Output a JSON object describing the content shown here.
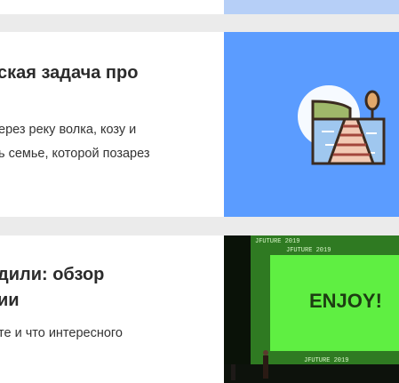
{
  "articles": [
    {
      "title_lines": [
        "ская задача про"
      ],
      "excerpt_lines": [
        "ерез реку волка, козу и",
        "ь семье, которой позарез"
      ],
      "thumb_color": "#5b9cff"
    },
    {
      "title_lines": [
        "дили: обзор",
        "ии"
      ],
      "excerpt_lines": [
        "те и что интересного"
      ],
      "thumb_color": "#4ee04c",
      "screen_text": "ENJOY!",
      "banner_text": "JFUTURE 2019"
    }
  ],
  "colors": {
    "page_bg": "#ebebeb",
    "card_bg": "#ffffff",
    "top_thumb": "#b6cff7"
  }
}
